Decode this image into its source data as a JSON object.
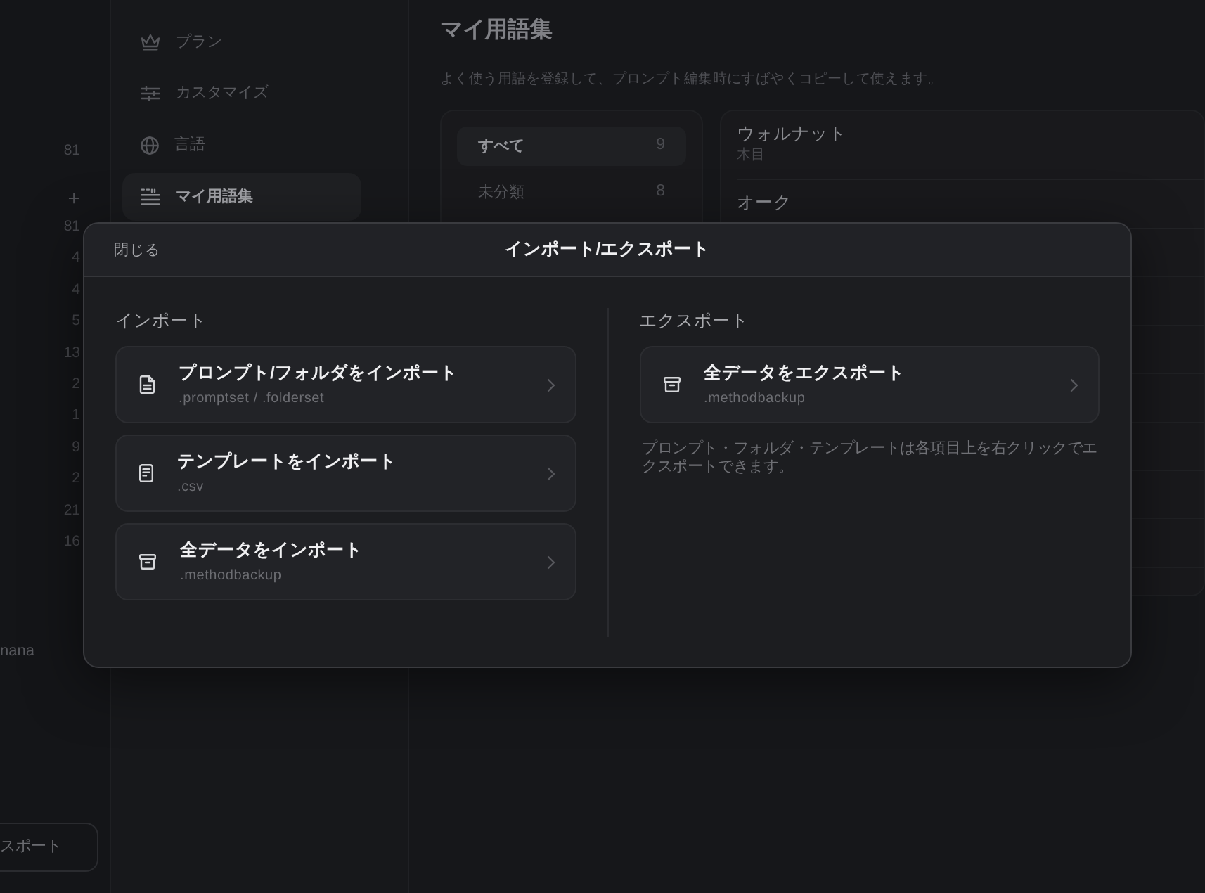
{
  "rail": {
    "items": [
      {
        "kind": "count",
        "text": "81"
      },
      {
        "kind": "add",
        "text": "+"
      },
      {
        "kind": "count",
        "text": "81"
      },
      {
        "kind": "count",
        "text": "4"
      },
      {
        "kind": "count",
        "text": "4"
      },
      {
        "kind": "count",
        "text": "5"
      },
      {
        "kind": "count",
        "text": "13"
      },
      {
        "kind": "count",
        "text": "2"
      },
      {
        "kind": "count",
        "text": "1"
      },
      {
        "kind": "count",
        "text": "9"
      },
      {
        "kind": "count",
        "text": "2"
      },
      {
        "kind": "count",
        "text": "21"
      },
      {
        "kind": "count",
        "text": "16"
      }
    ],
    "user_name": "nana",
    "button": "スポート"
  },
  "sidebar": {
    "items": [
      {
        "kind": "plan",
        "label": "プラン",
        "selected": false
      },
      {
        "kind": "customize",
        "label": "カスタマイズ",
        "selected": false
      },
      {
        "kind": "language",
        "label": "言語",
        "selected": false
      },
      {
        "kind": "glossary",
        "label": "マイ用語集",
        "selected": true
      }
    ]
  },
  "main": {
    "title": "マイ用語集",
    "description": "よく使う用語を登録して、プロンプト編集時にすばやくコピーして使えます。",
    "categories": [
      {
        "label": "すべて",
        "count": "9",
        "selected": true
      },
      {
        "label": "未分類",
        "count": "8",
        "selected": false
      }
    ],
    "terms": [
      {
        "name": "ウォルナット",
        "category": "木目"
      },
      {
        "name": "オーク"
      }
    ]
  },
  "dialog": {
    "close": "閉じる",
    "title": "インポート/エクスポート",
    "import": {
      "heading": "インポート",
      "items": [
        {
          "kind": "prompts",
          "title": "プロンプト/フォルダをインポート",
          "formats": ".promptset / .folderset"
        },
        {
          "kind": "templates",
          "title": "テンプレートをインポート",
          "formats": ".csv"
        },
        {
          "kind": "backup",
          "title": "全データをインポート",
          "formats": ".methodbackup"
        }
      ]
    },
    "export": {
      "heading": "エクスポート",
      "items": [
        {
          "kind": "backup",
          "title": "全データをエクスポート",
          "formats": ".methodbackup"
        }
      ],
      "note": "プロンプト・フォルダ・テンプレートは各項目上を右クリックでエクスポートできます。"
    }
  }
}
